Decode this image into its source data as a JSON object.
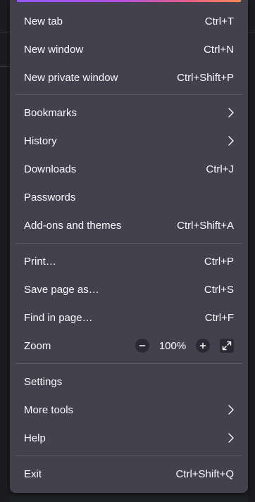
{
  "menu": {
    "items": {
      "new_tab": {
        "label": "New tab",
        "shortcut": "Ctrl+T"
      },
      "new_window": {
        "label": "New window",
        "shortcut": "Ctrl+N"
      },
      "new_private_window": {
        "label": "New private window",
        "shortcut": "Ctrl+Shift+P"
      },
      "bookmarks": {
        "label": "Bookmarks"
      },
      "history": {
        "label": "History"
      },
      "downloads": {
        "label": "Downloads",
        "shortcut": "Ctrl+J"
      },
      "passwords": {
        "label": "Passwords"
      },
      "addons": {
        "label": "Add-ons and themes",
        "shortcut": "Ctrl+Shift+A"
      },
      "print": {
        "label": "Print…",
        "shortcut": "Ctrl+P"
      },
      "save_page": {
        "label": "Save page as…",
        "shortcut": "Ctrl+S"
      },
      "find": {
        "label": "Find in page…",
        "shortcut": "Ctrl+F"
      },
      "zoom": {
        "label": "Zoom",
        "level": "100%"
      },
      "settings": {
        "label": "Settings"
      },
      "more_tools": {
        "label": "More tools"
      },
      "help": {
        "label": "Help"
      },
      "exit": {
        "label": "Exit",
        "shortcut": "Ctrl+Shift+Q"
      }
    },
    "icons": {
      "submenu": "chevron-right-icon",
      "zoom_out": "minus-icon",
      "zoom_in": "plus-icon",
      "fullscreen": "fullscreen-icon"
    },
    "colors": {
      "background": "#42414d",
      "text": "#fbfbfe",
      "separator": "#5b5b66",
      "accent_start": "#9059ff",
      "accent_end": "#ff8a50"
    }
  }
}
